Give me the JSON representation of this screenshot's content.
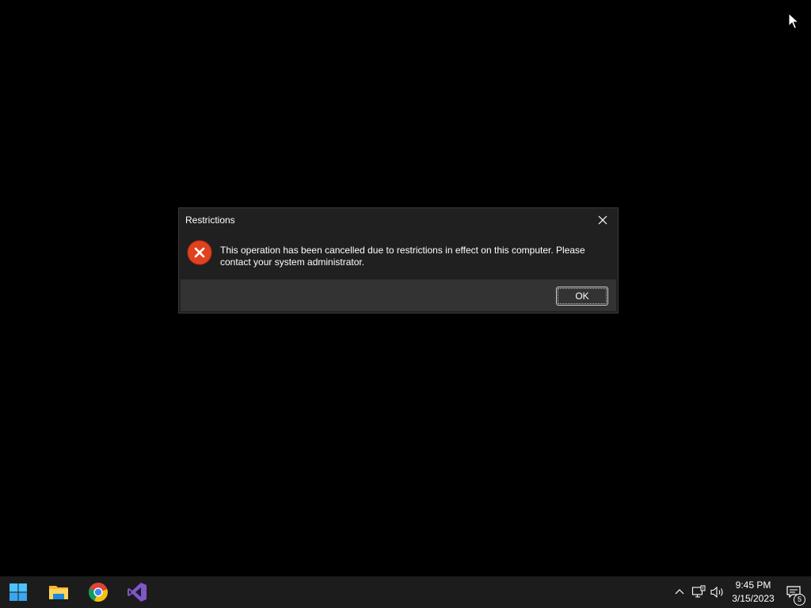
{
  "dialog": {
    "title": "Restrictions",
    "message": "This operation has been cancelled due to restrictions in effect on this computer. Please contact your system administrator.",
    "ok_label": "OK",
    "icon": "error-icon",
    "icon_color": "#e0421e"
  },
  "taskbar": {
    "apps": [
      {
        "name": "start",
        "icon": "windows-start-icon"
      },
      {
        "name": "file-explorer",
        "icon": "file-explorer-icon"
      },
      {
        "name": "chrome",
        "icon": "chrome-icon"
      },
      {
        "name": "visual-studio",
        "icon": "visual-studio-icon"
      }
    ],
    "tray": [
      "chevron-up-icon",
      "network-icon",
      "volume-icon"
    ],
    "time": "9:45 PM",
    "date": "3/15/2023",
    "notification_count": "5"
  },
  "colors": {
    "desktop_bg": "#000000",
    "taskbar_bg": "#1c1c1c",
    "dialog_bg": "#202020",
    "dialog_footer_bg": "#333333"
  }
}
